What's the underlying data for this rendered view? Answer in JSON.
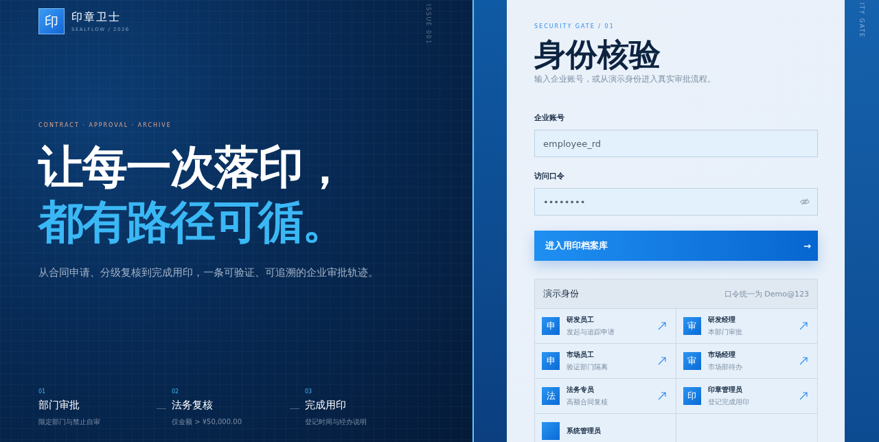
{
  "brand": {
    "logo_glyph": "印",
    "name": "印章卫士",
    "sub": "SEALFLOW / 2026"
  },
  "issue_label": "ISSUE 001",
  "hero": {
    "eyebrow": "CONTRACT · APPROVAL · ARCHIVE",
    "line_1": "让每一次落印，",
    "line_2": "都有路径可循。",
    "description": "从合同申请、分级复核到完成用印，一条可验证、可追溯的企业审批轨迹。"
  },
  "steps": [
    {
      "number": "01",
      "title": "部门审批",
      "note": "限定部门与禁止自审"
    },
    {
      "number": "02",
      "title": "法务复核",
      "note": "仅金额 > ¥50,000.00"
    },
    {
      "number": "03",
      "title": "完成用印",
      "note": "登记时间与经办说明"
    }
  ],
  "side_label": "ITY GATE",
  "login": {
    "eyebrow": "SECURITY GATE / 01",
    "title": "身份核验",
    "subtitle": "输入企业账号，或从演示身份进入真实审批流程。",
    "account_label": "企业账号",
    "account_value": "employee_rd",
    "password_label": "访问口令",
    "password_value": "••••••••",
    "submit": "进入用印档案库",
    "submit_arrow": "→"
  },
  "demo": {
    "title": "演示身份",
    "hint": "口令统一为 Demo@123",
    "items": [
      {
        "badge": "申",
        "name": "研发员工",
        "desc": "发起与追踪申请"
      },
      {
        "badge": "审",
        "name": "研发经理",
        "desc": "本部门审批"
      },
      {
        "badge": "申",
        "name": "市场员工",
        "desc": "验证部门隔离"
      },
      {
        "badge": "审",
        "name": "市场经理",
        "desc": "市场部待办"
      },
      {
        "badge": "法",
        "name": "法务专员",
        "desc": "高额合同复核"
      },
      {
        "badge": "印",
        "name": "印章管理员",
        "desc": "登记完成用印"
      },
      {
        "name": "系统管理员"
      }
    ]
  }
}
